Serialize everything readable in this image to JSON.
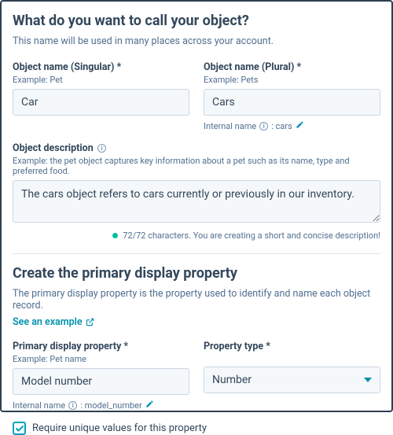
{
  "section1": {
    "heading": "What do you want to call your object?",
    "subtitle": "This name will be used in many places across your account.",
    "singular": {
      "label": "Object name (Singular) *",
      "example": "Example: Pet",
      "value": "Car"
    },
    "plural": {
      "label": "Object name (Plural) *",
      "example": "Example: Pets",
      "value": "Cars",
      "internal_label": "Internal name",
      "internal_value": ": cars"
    },
    "description": {
      "label": "Object description",
      "example": "Example: the pet object captures key information about a pet such as its name, type and preferred food.",
      "value": "The cars object refers to cars currently or previously in our inventory.",
      "char_note": "72/72 characters. You are creating a short and concise description!"
    }
  },
  "section2": {
    "heading": "Create the primary display property",
    "subtitle": "The primary display property is the property used to identify and name each object record.",
    "link": "See an example",
    "property": {
      "label": "Primary display property *",
      "example": "Example: Pet name",
      "value": "Model number",
      "internal_label": "Internal name",
      "internal_value": ": model_number"
    },
    "type": {
      "label": "Property type *",
      "value": "Number"
    },
    "checkbox_label": "Require unique values for this property"
  }
}
